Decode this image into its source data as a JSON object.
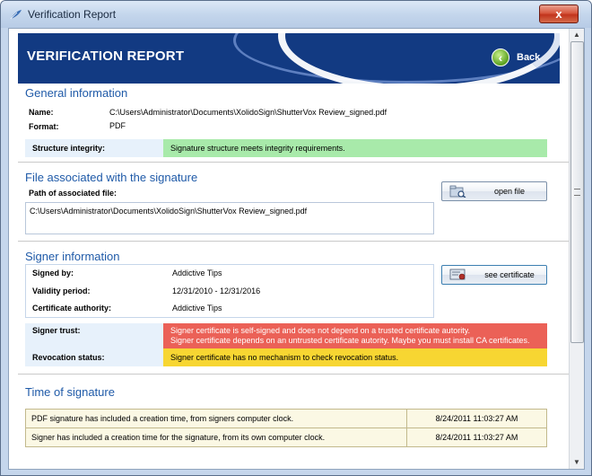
{
  "window": {
    "title": "Verification Report",
    "close_glyph": "x"
  },
  "header": {
    "title": "VERIFICATION REPORT",
    "back_label": "Back"
  },
  "general": {
    "title": "General information",
    "name_label": "Name:",
    "name_value": "C:\\Users\\Administrator\\Documents\\XolidoSign\\ShutterVox Review_signed.pdf",
    "format_label": "Format:",
    "format_value": "PDF",
    "integrity_label": "Structure integrity:",
    "integrity_value": "Signature structure meets integrity requirements."
  },
  "associated": {
    "title": "File associated with the signature",
    "path_label": "Path of associated file:",
    "path_value": "C:\\Users\\Administrator\\Documents\\XolidoSign\\ShutterVox Review_signed.pdf",
    "open_button": "open file"
  },
  "signer": {
    "title": "Signer information",
    "signed_by_label": "Signed by:",
    "signed_by_value": "Addictive Tips",
    "validity_label": "Validity period:",
    "validity_value": "12/31/2010 - 12/31/2016",
    "ca_label": "Certificate authority:",
    "ca_value": "Addictive Tips",
    "cert_button": "see certificate",
    "trust_label": "Signer trust:",
    "trust_line1": "Signer certificate is self-signed and does not depend on a trusted certificate autority.",
    "trust_line2": "Signer certificate depends on an untrusted certificate autority. Maybe you must install CA certificates.",
    "revocation_label": "Revocation status:",
    "revocation_value": "Signer certificate has no mechanism to check revocation status."
  },
  "time": {
    "title": "Time of signature",
    "rows": [
      {
        "text": "PDF signature has included a creation time, from signers computer clock.",
        "time": "8/24/2011 11:03:27 AM"
      },
      {
        "text": "Signer has included a creation time for the signature, from its own computer clock.",
        "time": "8/24/2011 11:03:27 AM"
      }
    ]
  },
  "colors": {
    "header_bg": "#123a82",
    "section_title": "#1f5aa8",
    "ok_green": "#a8eaaa",
    "error_red": "#eb6157",
    "warn_yellow": "#f7d632",
    "time_row_bg": "#fbf8e4"
  },
  "icons": {
    "app": "app-feather-icon",
    "back": "back-arrow-icon",
    "open_file": "folder-search-icon",
    "certificate": "certificate-icon"
  }
}
